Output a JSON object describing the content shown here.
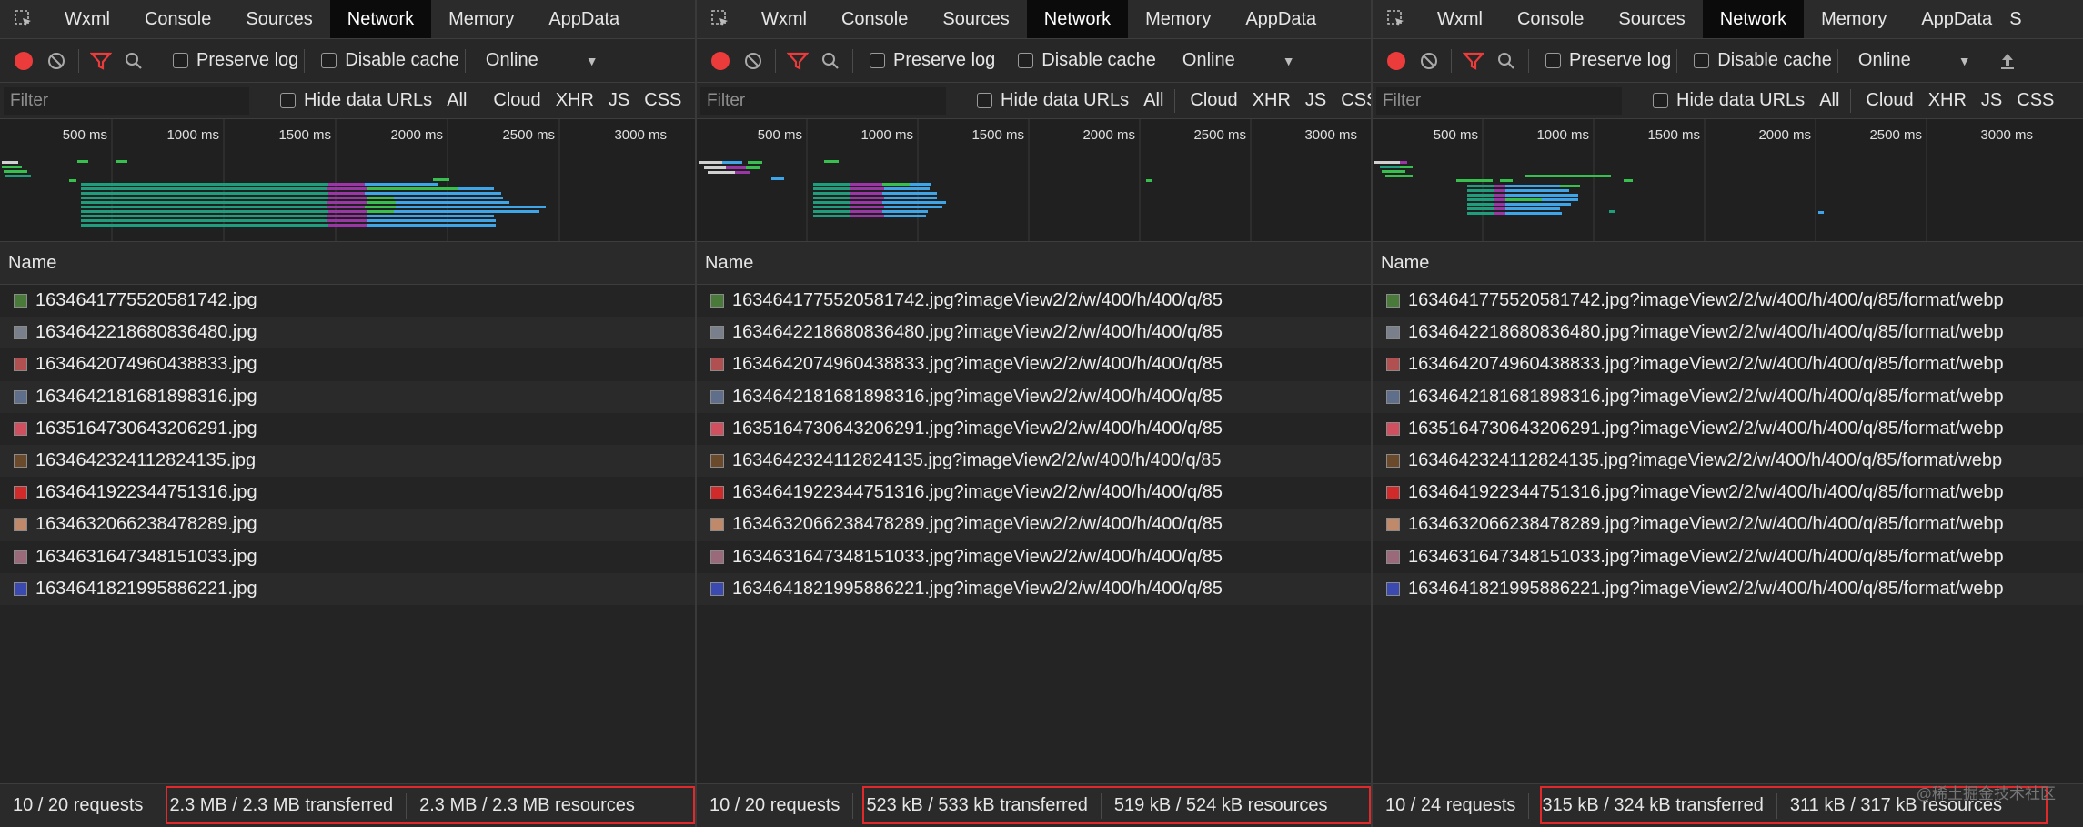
{
  "tabs": [
    "Wxml",
    "Console",
    "Sources",
    "Network",
    "Memory",
    "AppData",
    "S"
  ],
  "active_tab": "Network",
  "toolbar": {
    "preserve_log": "Preserve log",
    "disable_cache": "Disable cache",
    "throttle": "Online"
  },
  "filterbar": {
    "placeholder": "Filter",
    "hide_data_urls": "Hide data URLs",
    "types": [
      "All",
      "Cloud",
      "XHR",
      "JS",
      "CSS"
    ]
  },
  "timeline": {
    "ticks": [
      "500 ms",
      "1000 ms",
      "1500 ms",
      "2000 ms",
      "2500 ms",
      "3000 ms"
    ],
    "colors": {
      "waiting": "#1f9e7e",
      "download": "#3ea6e8",
      "queued": "#9b36a6",
      "green": "#37c04e",
      "gray": "#d0d0d0"
    }
  },
  "column_header": "Name",
  "thumb_colors": [
    "#4a7a3a",
    "#7a7f8c",
    "#b05050",
    "#5f6e8a",
    "#d05060",
    "#6a4a2a",
    "#d02a2a",
    "#c08a6a",
    "#9a6a7a",
    "#3a4ab0"
  ],
  "panels": [
    {
      "files": [
        "1634641775520581742.jpg",
        "1634642218680836480.jpg",
        "1634642074960438833.jpg",
        "1634642181681898316.jpg",
        "1635164730643206291.jpg",
        "1634642324112824135.jpg",
        "1634641922344751316.jpg",
        "1634632066238478289.jpg",
        "1634631647348151033.jpg",
        "1634641821995886221.jpg"
      ],
      "status": {
        "requests": "10 / 20 requests",
        "transferred": "2.3 MB / 2.3 MB transferred",
        "resources": "2.3 MB / 2.3 MB resources"
      }
    },
    {
      "files": [
        "1634641775520581742.jpg?imageView2/2/w/400/h/400/q/85",
        "1634642218680836480.jpg?imageView2/2/w/400/h/400/q/85",
        "1634642074960438833.jpg?imageView2/2/w/400/h/400/q/85",
        "1634642181681898316.jpg?imageView2/2/w/400/h/400/q/85",
        "1635164730643206291.jpg?imageView2/2/w/400/h/400/q/85",
        "1634642324112824135.jpg?imageView2/2/w/400/h/400/q/85",
        "1634641922344751316.jpg?imageView2/2/w/400/h/400/q/85",
        "1634632066238478289.jpg?imageView2/2/w/400/h/400/q/85",
        "1634631647348151033.jpg?imageView2/2/w/400/h/400/q/85",
        "1634641821995886221.jpg?imageView2/2/w/400/h/400/q/85"
      ],
      "status": {
        "requests": "10 / 20 requests",
        "transferred": "523 kB / 533 kB transferred",
        "resources": "519 kB / 524 kB resources"
      }
    },
    {
      "files": [
        "1634641775520581742.jpg?imageView2/2/w/400/h/400/q/85/format/webp",
        "1634642218680836480.jpg?imageView2/2/w/400/h/400/q/85/format/webp",
        "1634642074960438833.jpg?imageView2/2/w/400/h/400/q/85/format/webp",
        "1634642181681898316.jpg?imageView2/2/w/400/h/400/q/85/format/webp",
        "1635164730643206291.jpg?imageView2/2/w/400/h/400/q/85/format/webp",
        "1634642324112824135.jpg?imageView2/2/w/400/h/400/q/85/format/webp",
        "1634641922344751316.jpg?imageView2/2/w/400/h/400/q/85/format/webp",
        "1634632066238478289.jpg?imageView2/2/w/400/h/400/q/85/format/webp",
        "1634631647348151033.jpg?imageView2/2/w/400/h/400/q/85/format/webp",
        "1634641821995886221.jpg?imageView2/2/w/400/h/400/q/85/format/webp"
      ],
      "status": {
        "requests": "10 / 24 requests",
        "transferred": "315 kB / 324 kB transferred",
        "resources": "311 kB / 317 kB resources"
      }
    }
  ],
  "watermark": "@稀土掘金技术社区"
}
